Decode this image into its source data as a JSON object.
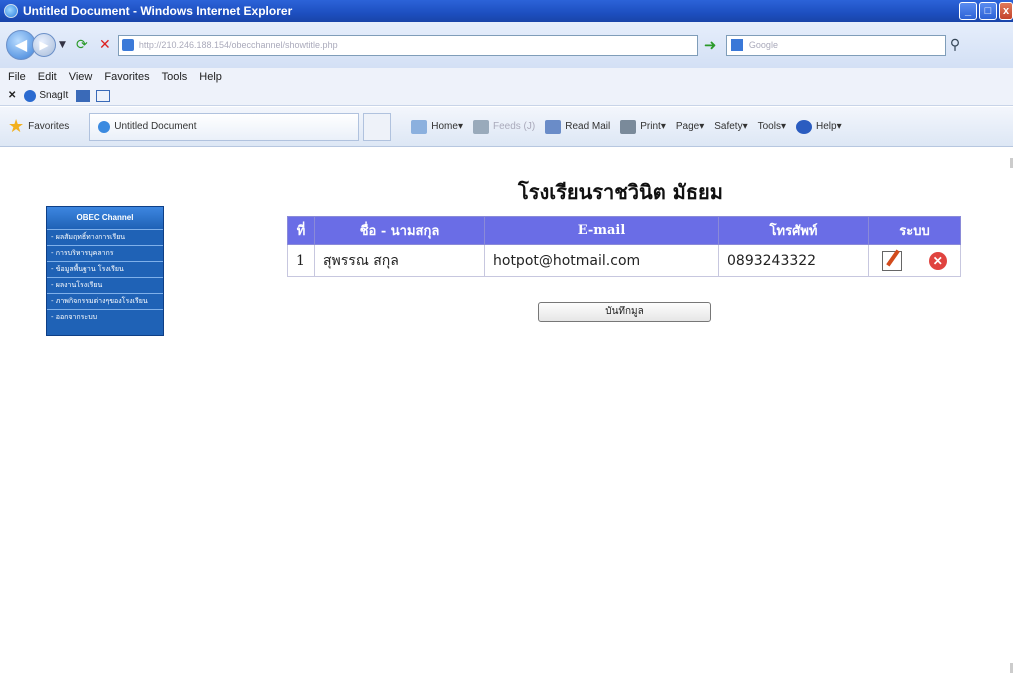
{
  "window": {
    "title": "Untitled Document - Windows Internet Explorer"
  },
  "browser": {
    "url": "http://210.246.188.154/obecchannel/showtitle.php",
    "search_placeholder": "Google",
    "menu": [
      "File",
      "Edit",
      "View",
      "Favorites",
      "Tools",
      "Help"
    ],
    "snagit_label": "SnagIt",
    "favorites_label": "Favorites",
    "tab_title": "Untitled Document",
    "commands": [
      "Home",
      "Feeds (J)",
      "Read Mail",
      "Print",
      "Page",
      "Safety",
      "Tools",
      "Help"
    ]
  },
  "page": {
    "school_name": "โรงเรียนราชวินิต มัธยม",
    "save_button_label": "บันทึกมูล"
  },
  "sidebar": {
    "header": "OBEC Channel",
    "items": [
      "- ผลสัมฤทธิ์ทางการเรียน",
      "- การบริหารบุคลากร",
      "- ข้อมูลพื้นฐาน โรงเรียน",
      "- ผลงานโรงเรียน",
      "- ภาพกิจกรรมต่างๆของโรงเรียน",
      "- ออกจากระบบ"
    ]
  },
  "table": {
    "headers": [
      "ที่",
      "ชื่อ - นามสกุล",
      "E-mail",
      "โทรศัพท์",
      "ระบบ"
    ],
    "rows": [
      {
        "no": "1",
        "name": "สุพรรณ สกุล",
        "email": "hotpot@hotmail.com",
        "phone": "0893243322"
      }
    ]
  },
  "icons": {
    "edit": "edit-icon",
    "delete": "delete-icon"
  }
}
